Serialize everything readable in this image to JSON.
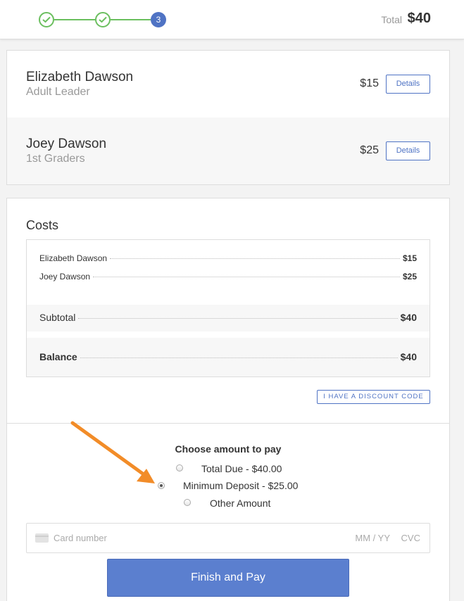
{
  "header": {
    "steps": [
      {
        "state": "done",
        "icon": "check-icon"
      },
      {
        "state": "done",
        "icon": "check-icon"
      },
      {
        "state": "active",
        "label": "3"
      }
    ],
    "total_label": "Total",
    "total_value": "$40"
  },
  "attendees": [
    {
      "name": "Elizabeth Dawson",
      "role": "Adult Leader",
      "price": "$15",
      "details_label": "Details"
    },
    {
      "name": "Joey Dawson",
      "role": "1st Graders",
      "price": "$25",
      "details_label": "Details"
    }
  ],
  "costs": {
    "title": "Costs",
    "items": [
      {
        "label": "Elizabeth Dawson",
        "amount": "$15"
      },
      {
        "label": "Joey Dawson",
        "amount": "$25"
      }
    ],
    "subtotal_label": "Subtotal",
    "subtotal_amount": "$40",
    "balance_label": "Balance",
    "balance_amount": "$40",
    "discount_label": "I HAVE A DISCOUNT CODE"
  },
  "payment": {
    "choose_title": "Choose amount to pay",
    "options": [
      {
        "label": "Total Due - $40.00",
        "checked": false
      },
      {
        "label": "Minimum Deposit - $25.00",
        "checked": true
      },
      {
        "label": "Other Amount",
        "checked": false
      }
    ],
    "card_placeholder": "Card number",
    "expiry_placeholder": "MM / YY",
    "cvc_placeholder": "CVC",
    "pay_label": "Finish and Pay"
  },
  "colors": {
    "accent": "#4f73c4",
    "success": "#6bbf5f",
    "annotation_arrow": "#f28c28"
  }
}
